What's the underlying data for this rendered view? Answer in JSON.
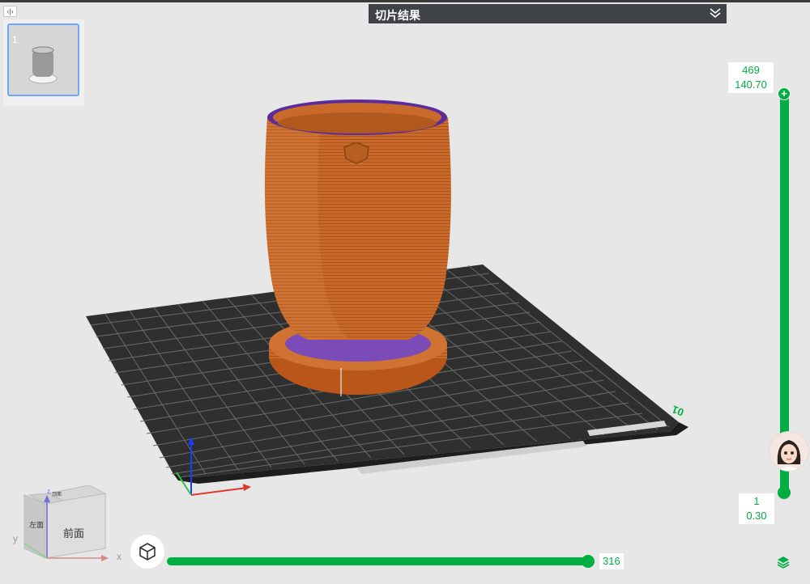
{
  "app": {
    "collapse_toggle_glyph": "‹|›"
  },
  "plate_thumbnails": [
    {
      "number": "1"
    }
  ],
  "header": {
    "title": "切片结果",
    "collapse_icon": "double-chevron-down-icon"
  },
  "layer_slider": {
    "top_layer": "469",
    "top_height": "140.70",
    "bottom_layer": "1",
    "bottom_height": "0.30",
    "top_handle_glyph": "+",
    "accent": "#00ae42"
  },
  "move_slider": {
    "value": "316",
    "progress": 1.0
  },
  "plate": {
    "number": "01"
  },
  "nav_cube": {
    "front_label": "前面",
    "left_label": "左面",
    "top_label": "顶面",
    "x_label": "x",
    "y_label": "y",
    "z_label": "z"
  },
  "model": {
    "color": "#c96a2a",
    "brim_color": "#7b4bb8"
  }
}
